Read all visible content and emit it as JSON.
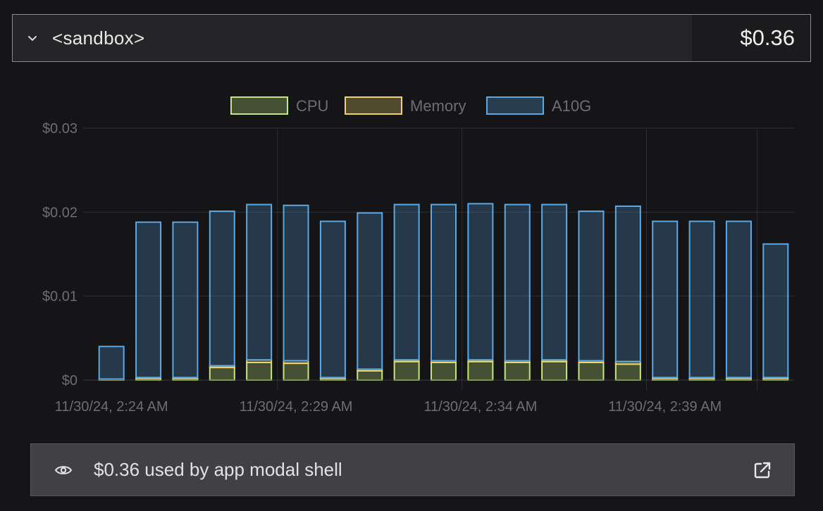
{
  "header": {
    "title": "<sandbox>",
    "total": "$0.36",
    "expand_icon": "chevron-down-icon"
  },
  "footer": {
    "text": "$0.36 used by app modal shell",
    "view_icon": "eye-icon",
    "link_icon": "external-link-icon"
  },
  "colors": {
    "cpu": "#c5e87a",
    "memory": "#f2d36b",
    "gpu": "#5aa8e6",
    "grid": "#2e2e31",
    "axis_text": "#6d6d72",
    "legend_text": "#6d6d72"
  },
  "chart_data": {
    "type": "bar",
    "stacked": true,
    "y_tick_labels": [
      "$0",
      "$0.01",
      "$0.02",
      "$0.03"
    ],
    "y_ticks": [
      0,
      0.01,
      0.02,
      0.03
    ],
    "ylim": [
      0,
      0.03
    ],
    "x_tick_labels": [
      "11/30/24, 2:24 AM",
      "11/30/24, 2:29 AM",
      "11/30/24, 2:34 AM",
      "11/30/24, 2:39 AM"
    ],
    "categories": [
      "2:24",
      "2:25",
      "2:26",
      "2:27",
      "2:28",
      "2:29",
      "2:30",
      "2:31",
      "2:32",
      "2:33",
      "2:34",
      "2:35",
      "2:36",
      "2:37",
      "2:38",
      "2:39",
      "2:40",
      "2:41",
      "2:42"
    ],
    "grid": true,
    "legend_position": "top-center",
    "series": [
      {
        "name": "CPU",
        "values": [
          0.0001,
          0.0002,
          0.0002,
          0.0015,
          0.0021,
          0.002,
          0.0002,
          0.0011,
          0.0022,
          0.0021,
          0.0022,
          0.0021,
          0.0022,
          0.0021,
          0.0019,
          0.0002,
          0.0002,
          0.0002,
          0.0002
        ]
      },
      {
        "name": "Memory",
        "values": [
          0.0,
          0.0001,
          0.0001,
          0.0002,
          0.0003,
          0.0003,
          0.0001,
          0.0002,
          0.0002,
          0.0002,
          0.0002,
          0.0002,
          0.0002,
          0.0002,
          0.0003,
          0.0001,
          0.0001,
          0.0001,
          0.0001
        ]
      },
      {
        "name": "A10G",
        "values": [
          0.0039,
          0.0185,
          0.0185,
          0.0184,
          0.0185,
          0.0185,
          0.0186,
          0.0186,
          0.0185,
          0.0186,
          0.0186,
          0.0186,
          0.0185,
          0.0178,
          0.0185,
          0.0186,
          0.0186,
          0.0186,
          0.0159
        ]
      }
    ]
  }
}
